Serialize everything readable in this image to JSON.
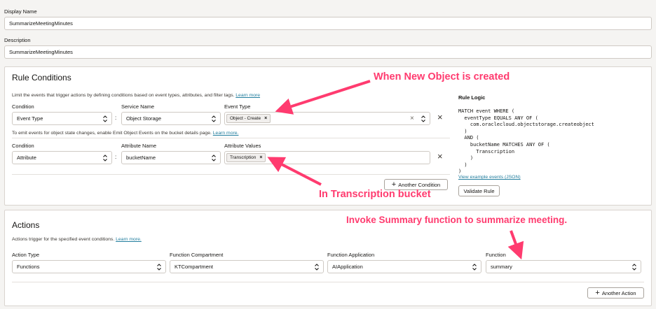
{
  "display_name": {
    "label": "Display Name",
    "value": "SummarizeMeetingMinutes"
  },
  "description": {
    "label": "Description",
    "value": "SummarizeMeetingMinutes"
  },
  "rule_conditions": {
    "title": "Rule Conditions",
    "intro": "Limit the events that trigger actions by defining conditions based on event types, attributes, and filter tags.",
    "intro_link": "Learn more",
    "row1": {
      "condition_label": "Condition",
      "condition_value": "Event Type",
      "service_label": "Service Name",
      "service_value": "Object Storage",
      "event_type_label": "Event Type",
      "chip": "Object - Create"
    },
    "emit_note": "To emit events for object state changes, enable Emit Object Events on the bucket details page.",
    "emit_link": "Learn more.",
    "row2": {
      "condition_label": "Condition",
      "condition_value": "Attribute",
      "attr_name_label": "Attribute Name",
      "attr_name_value": "bucketName",
      "attr_values_label": "Attribute Values",
      "chip": "Transcription"
    },
    "another_condition": "Another Condition"
  },
  "rule_logic": {
    "title": "Rule Logic",
    "code": "MATCH event WHERE (\n  eventType EQUALS ANY OF (\n    com.oraclecloud.objectstorage.createobject\n  )\n  AND (\n    bucketName MATCHES ANY OF (\n      Transcription\n    )\n  )\n)",
    "example_link": "View example events (JSON)",
    "validate": "Validate Rule"
  },
  "actions": {
    "title": "Actions",
    "intro": "Actions trigger for the specified event conditions.",
    "intro_link": "Learn more.",
    "action_type_label": "Action Type",
    "action_type_value": "Functions",
    "compartment_label": "Function Compartment",
    "compartment_value": "KTCompartment",
    "application_label": "Function Application",
    "application_value": "AIApplication",
    "function_label": "Function",
    "function_value": "summary",
    "another_action": "Another Action"
  },
  "annotations": {
    "new_object": "When New Object is created",
    "bucket": "In Transcription bucket",
    "invoke": "Invoke Summary function to summarize meeting."
  },
  "colors": {
    "annotation": "#ff3b6f",
    "link": "#227e9e"
  },
  "icons": [
    "select-arrows-icon",
    "close-icon",
    "chip-remove-icon",
    "plus-icon"
  ]
}
